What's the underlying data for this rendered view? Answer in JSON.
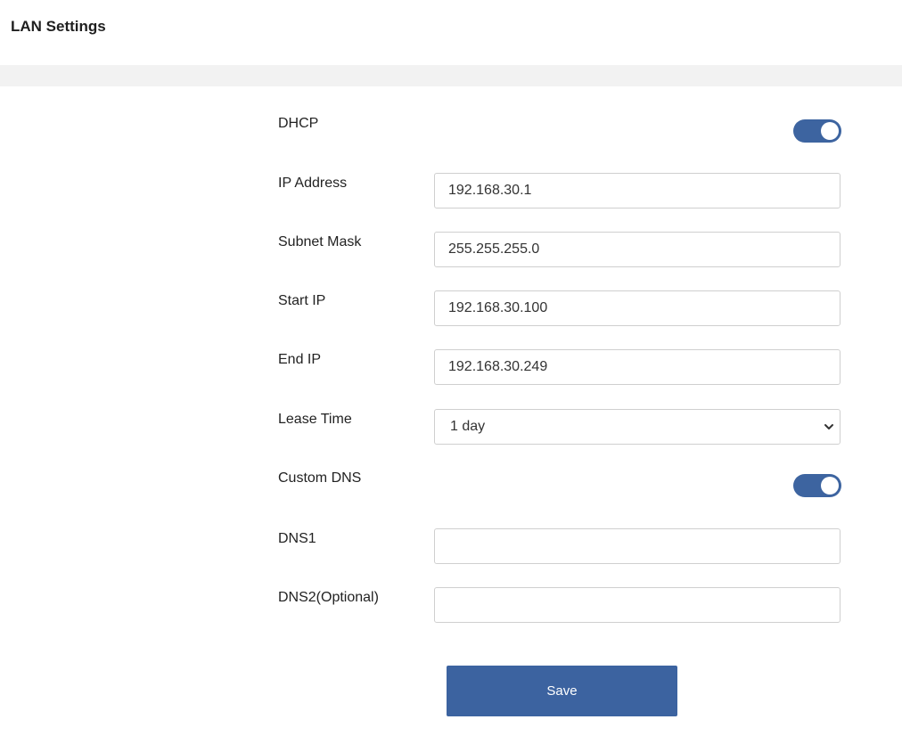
{
  "page": {
    "title": "LAN Settings"
  },
  "form": {
    "dhcp": {
      "label": "DHCP",
      "enabled": true
    },
    "ip_address": {
      "label": "IP Address",
      "value": "192.168.30.1"
    },
    "subnet_mask": {
      "label": "Subnet Mask",
      "value": "255.255.255.0"
    },
    "start_ip": {
      "label": "Start IP",
      "value": "192.168.30.100"
    },
    "end_ip": {
      "label": "End IP",
      "value": "192.168.30.249"
    },
    "lease_time": {
      "label": "Lease Time",
      "selected": "1 day"
    },
    "custom_dns": {
      "label": "Custom DNS",
      "enabled": true
    },
    "dns1": {
      "label": "DNS1",
      "value": ""
    },
    "dns2": {
      "label": "DNS2(Optional)",
      "value": ""
    },
    "save_label": "Save"
  },
  "icons": {
    "lease_time_dropdown": "chevron-down-icon"
  },
  "colors": {
    "accent": "#3c63a0",
    "band": "#f2f2f2",
    "input_border": "#cfcfcf"
  }
}
